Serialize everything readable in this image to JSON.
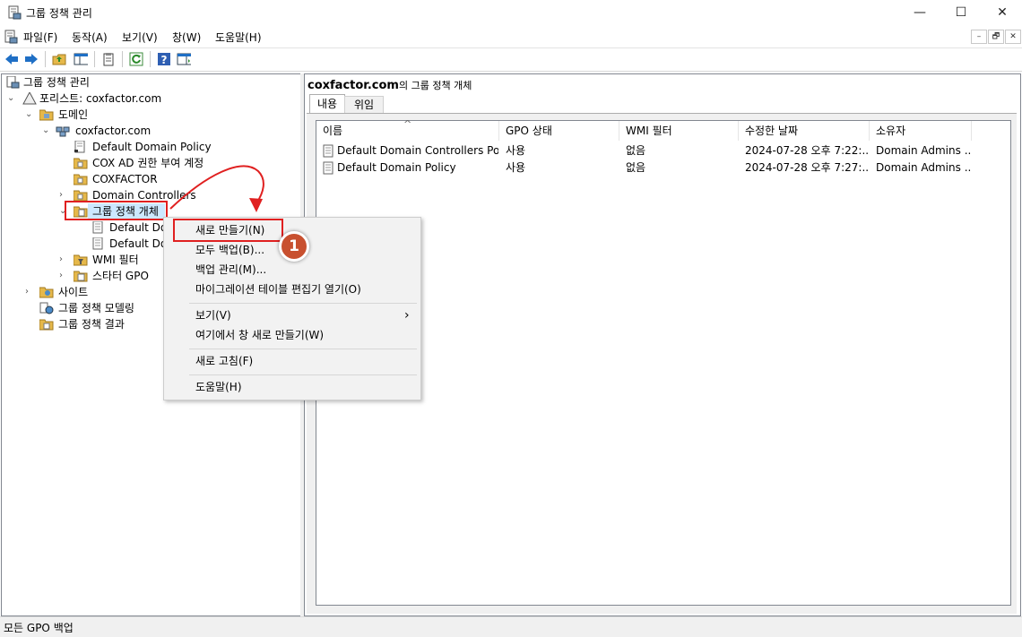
{
  "window": {
    "title": "그룹 정책 관리",
    "minimize_label": "—",
    "maximize_label": "☐",
    "close_label": "✕"
  },
  "menu": {
    "items": [
      "파일(F)",
      "동작(A)",
      "보기(V)",
      "창(W)",
      "도움말(H)"
    ],
    "mdi_min": "–",
    "mdi_restore": "🗗",
    "mdi_close": "✕"
  },
  "toolbar": {
    "icons": [
      "back-icon",
      "forward-icon",
      "up-folder-icon",
      "show-hide-tree-icon",
      "properties-icon",
      "refresh-icon",
      "help-icon",
      "action-pane-icon"
    ]
  },
  "tree": {
    "root": "그룹 정책 관리",
    "forest": "포리스트: coxfactor.com",
    "domains": "도메인",
    "domain": "coxfactor.com",
    "default_domain_policy": "Default Domain Policy",
    "cox_ad": "COX AD 권한 부여 계정",
    "coxfactor": "COXFACTOR",
    "domain_controllers": "Domain Controllers",
    "gpo_container": "그룹 정책 개체",
    "gpo_child1": "Default Dom",
    "gpo_child2": "Default Dom",
    "wmi_filters": "WMI 필터",
    "starter_gpo": "스타터 GPO",
    "sites": "사이트",
    "modeling": "그룹 정책 모델링",
    "results": "그룹 정책 결과"
  },
  "context_menu": {
    "new": "새로 만들기(N)",
    "backup_all": "모두 백업(B)...",
    "manage_backups": "백업 관리(M)...",
    "migration_table": "마이그레이션 테이블 편집기 열기(O)",
    "view": "보기(V)",
    "new_window": "여기에서 창 새로 만들기(W)",
    "refresh": "새로 고침(F)",
    "help": "도움말(H)",
    "submenu_arrow": "›"
  },
  "annotation": {
    "step_number": "1"
  },
  "right_pane": {
    "header_domain": "coxfactor.com",
    "header_suffix": "의 그룹 정책 개체",
    "tabs": [
      "내용",
      "위임"
    ],
    "columns": [
      "이름",
      "GPO 상태",
      "WMI 필터",
      "수정한 날짜",
      "소유자"
    ],
    "rows": [
      [
        "Default Domain Controllers Pol...",
        "사용",
        "없음",
        "2024-07-28 오후 7:22:...",
        "Domain Admins ..."
      ],
      [
        "Default Domain Policy",
        "사용",
        "없음",
        "2024-07-28 오후 7:27:...",
        "Domain Admins ..."
      ]
    ]
  },
  "status": {
    "text": "모든 GPO 백업"
  },
  "colors": {
    "highlight_red": "#e02020",
    "badge_fill": "#c8502f",
    "toolbar_blue": "#1f6fc5",
    "folder_yellow": "#e6b84a"
  }
}
